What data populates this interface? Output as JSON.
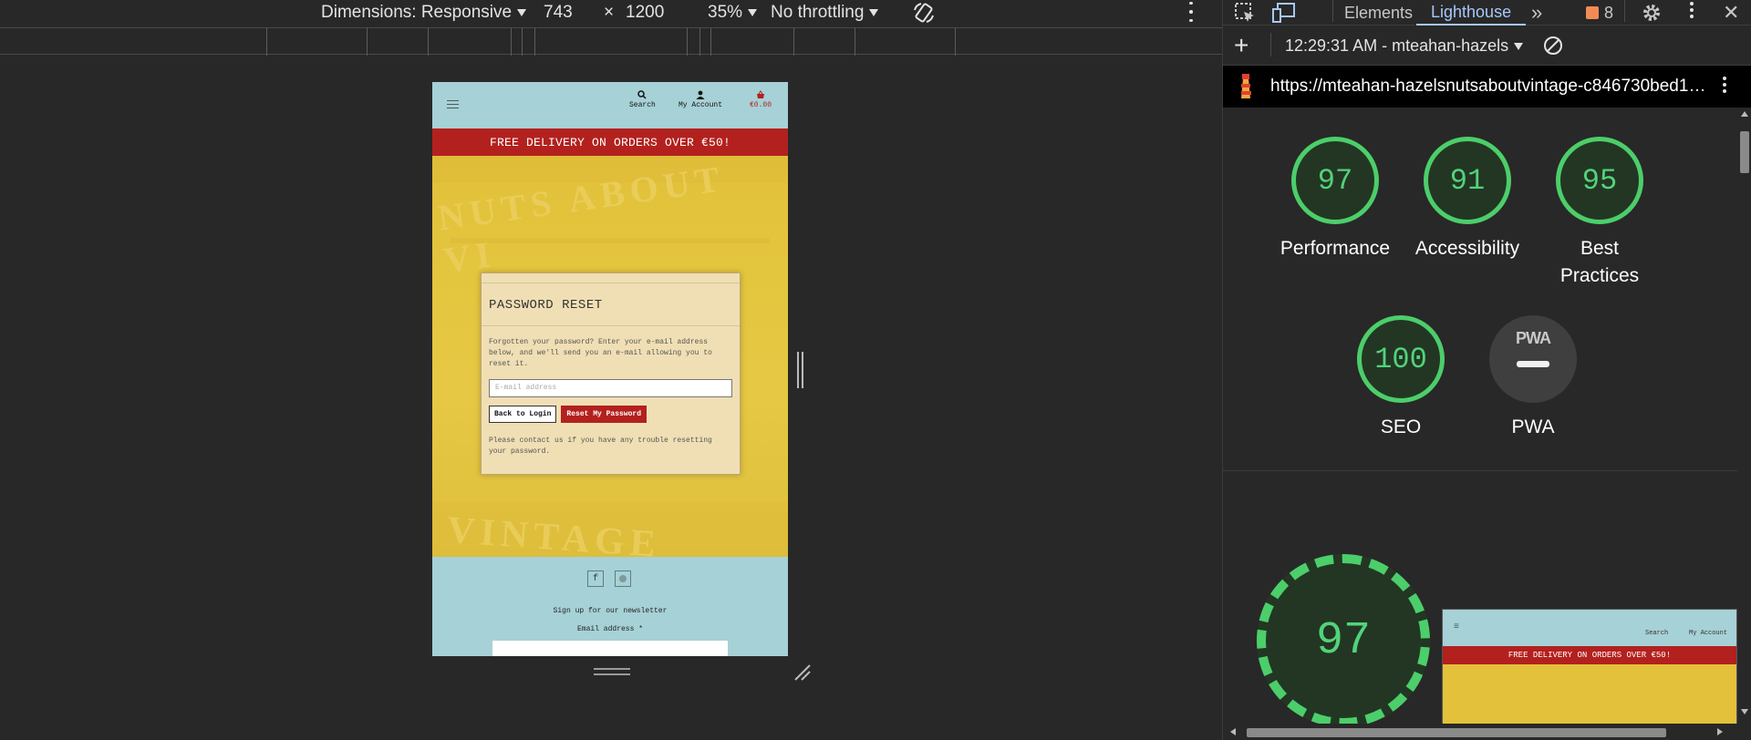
{
  "device_toolbar": {
    "dimensions_label": "Dimensions: Responsive",
    "width": "743",
    "times": "×",
    "height": "1200",
    "zoom": "35%",
    "throttling": "No throttling"
  },
  "site": {
    "nav": {
      "search": "Search",
      "account": "My Account",
      "cart_total": "€0.00"
    },
    "banner": "FREE DELIVERY ON ORDERS OVER €50!",
    "hero_words": {
      "top": "NUTS ABOUT VI",
      "bottom": "VINTAGE"
    },
    "card": {
      "title": "PASSWORD RESET",
      "description": "Forgotten your password? Enter your e-mail address below, and we'll send you an e-mail allowing you to reset it.",
      "email_placeholder": "E-mail address",
      "back_button": "Back to Login",
      "reset_button": "Reset My Password",
      "note": "Please contact us if you have any trouble resetting your password."
    },
    "footer": {
      "facebook": "f",
      "newsletter_heading": "Sign up for our newsletter",
      "email_label": "Email address *"
    }
  },
  "devtools": {
    "tabs": {
      "elements": "Elements",
      "lighthouse": "Lighthouse",
      "more": "»",
      "issues_count": "8"
    },
    "report_selector": "12:29:31 AM - mteahan-hazels",
    "url": "https://mteahan-hazelsnutsaboutvintage-c846730bed1…",
    "scores": [
      {
        "value": "97",
        "label": "Performance"
      },
      {
        "value": "91",
        "label": "Accessibility"
      },
      {
        "value": "95",
        "label": "Best Practices"
      },
      {
        "value": "100",
        "label": "SEO"
      }
    ],
    "pwa": {
      "logo": "PWA",
      "label": "PWA"
    },
    "main_score": "97",
    "thumbnail": {
      "search": "Search",
      "account": "My Account",
      "banner": "FREE DELIVERY ON ORDERS OVER €50!"
    }
  },
  "colors": {
    "accent": "#b3211e",
    "header": "#a6d1d6",
    "score_green": "#4cce6a",
    "hero": "#e3c13a"
  }
}
